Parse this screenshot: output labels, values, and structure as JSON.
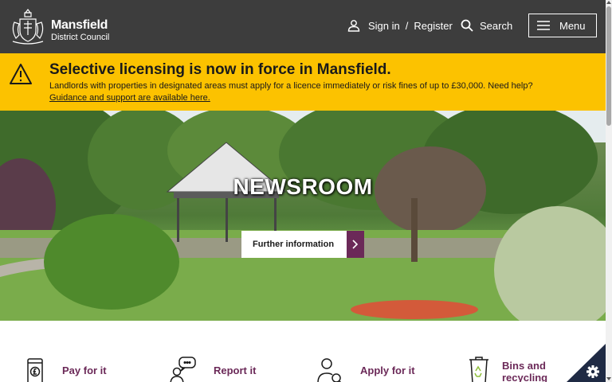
{
  "header": {
    "logo_name": "Mansfield",
    "logo_sub": "District Council",
    "signin_label": "Sign in",
    "separator": "/",
    "register_label": "Register",
    "search_label": "Search",
    "menu_label": "Menu",
    "background": "#3d3d3d"
  },
  "alert": {
    "title": "Selective licensing is now in force in Mansfield.",
    "body": "Landlords with properties in designated areas must apply for a licence immediately or risk fines of up to £30,000. Need help?",
    "link": "Guidance and support are available here.",
    "background": "#fcc200",
    "icon": "warning-triangle-icon"
  },
  "hero": {
    "title": "NEWSROOM",
    "button_label": "Further information",
    "accent": "#6b2958"
  },
  "quick_links": [
    {
      "label": "Pay for it",
      "icon": "phone-pound-icon"
    },
    {
      "label": "Report it",
      "icon": "person-speech-icon"
    },
    {
      "label": "Apply for it",
      "icon": "person-search-icon"
    },
    {
      "label_line1": "Bins and",
      "label_line2": "recycling",
      "icon": "recycling-bin-icon"
    }
  ],
  "cookie": {
    "icon": "gear-icon",
    "color": "#1f2a44"
  }
}
